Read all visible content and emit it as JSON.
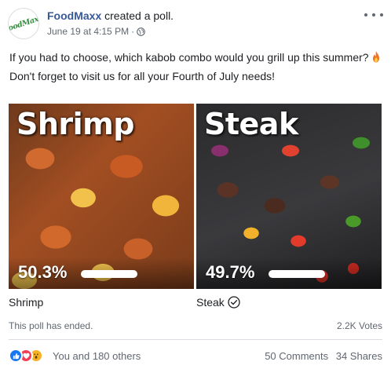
{
  "post": {
    "author": "FoodMaxx",
    "action": "created a poll.",
    "avatar_text": "FoodMaxx",
    "timestamp": "June 19 at 4:15 PM",
    "separator": "·",
    "privacy_icon": "globe-icon",
    "more_icon": "more-horizontal-icon",
    "text_lines": [
      "If you had to choose, which kabob combo would you grill up this summer?",
      "Don't forget to visit us for all your Fourth of July needs!"
    ],
    "emoji": "fire-icon"
  },
  "poll": {
    "options": [
      {
        "title": "Shrimp",
        "percent_label": "50.3%",
        "percent": 50.3,
        "label": "Shrimp",
        "selected": false
      },
      {
        "title": "Steak",
        "percent_label": "49.7%",
        "percent": 49.7,
        "label": "Steak",
        "selected": true
      }
    ],
    "status": "This poll has ended.",
    "votes": "2.2K Votes"
  },
  "footer": {
    "reactions": [
      "like-icon",
      "love-icon",
      "wow-icon"
    ],
    "reaction_names": "You and 180 others",
    "comments": "50 Comments",
    "shares": "34 Shares"
  },
  "colors": {
    "author_link": "#385898",
    "secondary_text": "#606770",
    "like": "#1877f2",
    "love": "#f33e58",
    "wow": "#f7b125"
  }
}
